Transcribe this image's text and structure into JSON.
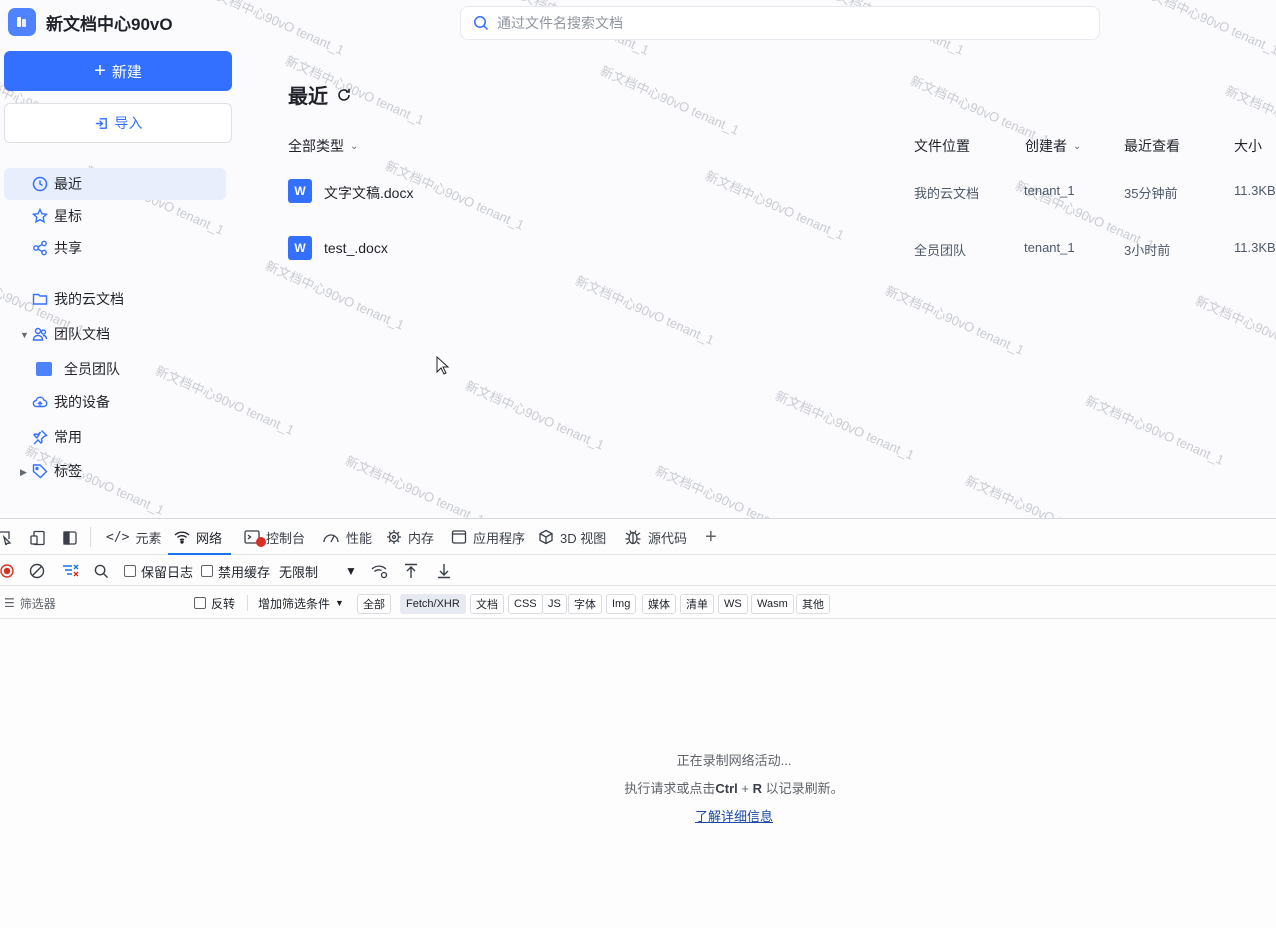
{
  "app": {
    "brand_title": "新文档中心90vO",
    "new_button": "新建",
    "import_button": "导入",
    "search_placeholder": "通过文件名搜索文档",
    "nav": {
      "recent": "最近",
      "starred": "星标",
      "shared": "共享",
      "my_cloud": "我的云文档",
      "team_docs": "团队文档",
      "all_members_team": "全员团队",
      "my_devices": "我的设备",
      "frequent": "常用",
      "tags": "标签"
    },
    "page_title": "最近",
    "table": {
      "headers": {
        "type_filter": "全部类型",
        "location": "文件位置",
        "creator": "创建者",
        "last_viewed": "最近查看",
        "size": "大小"
      },
      "rows": [
        {
          "icon": "W",
          "name": "文字文稿.docx",
          "location": "我的云文档",
          "creator": "tenant_1",
          "last_viewed": "35分钟前",
          "size": "11.3KB"
        },
        {
          "icon": "W",
          "name": "test_.docx",
          "location": "全员团队",
          "creator": "tenant_1",
          "last_viewed": "3小时前",
          "size": "11.3KB"
        }
      ]
    },
    "watermark_text": "新文档中心90vO tenant_1"
  },
  "devtools": {
    "tabs": {
      "elements": "元素",
      "network": "网络",
      "console": "控制台",
      "performance": "性能",
      "memory": "内存",
      "application": "应用程序",
      "view3d": "3D 视图",
      "sources": "源代码"
    },
    "toolbar": {
      "preserve_log": "保留日志",
      "disable_cache": "禁用缓存",
      "throttling": "无限制"
    },
    "filter": {
      "placeholder": "筛选器",
      "invert": "反转",
      "more_filters": "增加筛选条件",
      "chips": [
        "全部",
        "Fetch/XHR",
        "文档",
        "CSS",
        "JS",
        "字体",
        "Img",
        "媒体",
        "清单",
        "WS",
        "Wasm",
        "其他"
      ],
      "selected": "Fetch/XHR"
    },
    "empty": {
      "line1": "正在录制网络活动...",
      "line2_prefix": "执行请求或点击",
      "shortcut_ctrl": "Ctrl",
      "shortcut_plus": "+",
      "shortcut_r": "R",
      "line2_suffix": "以记录刷新。",
      "link": "了解详细信息"
    }
  },
  "colors": {
    "accent": "#3370ff",
    "devtools_accent": "#1a73e8",
    "record_red": "#d93025"
  }
}
